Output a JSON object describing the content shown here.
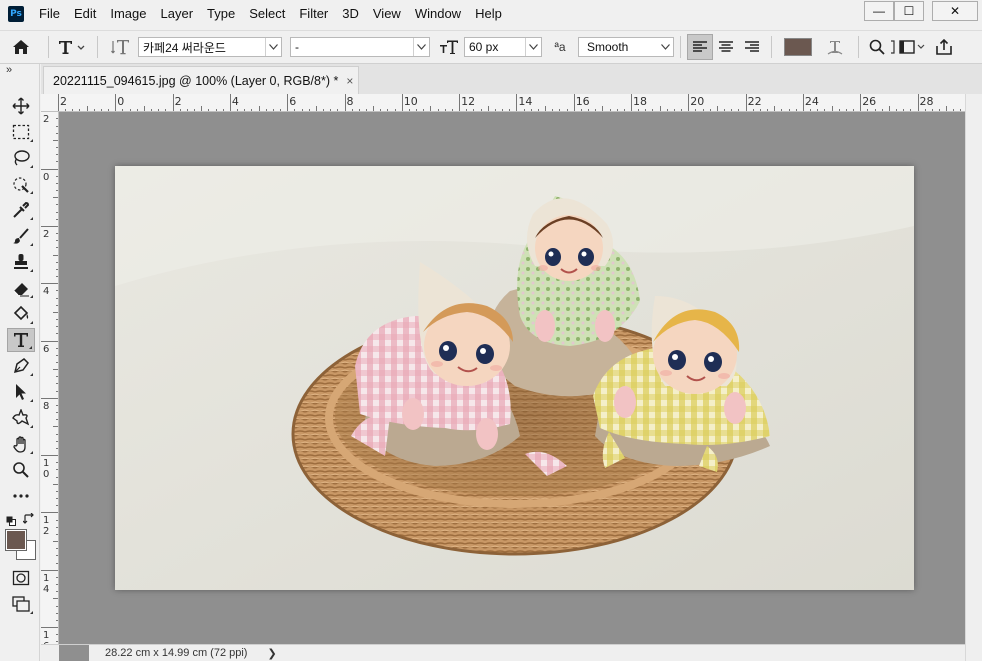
{
  "app": {
    "logo_text": "Ps",
    "menu": [
      "File",
      "Edit",
      "Image",
      "Layer",
      "Type",
      "Select",
      "Filter",
      "3D",
      "View",
      "Window",
      "Help"
    ],
    "window_controls": {
      "minimize": "—",
      "maximize": "☐",
      "close": "✕"
    }
  },
  "options": {
    "font_family": "카페24 써라운드",
    "font_style": "-",
    "font_size": "60 px",
    "antialias_label": "ªa",
    "antialias": "Smooth",
    "text_color": "#6b5850"
  },
  "document": {
    "tab_title": "20221115_094615.jpg @ 100% (Layer 0, RGB/8*) *",
    "tab_close": "×",
    "size_info": "28.22 cm x 14.99 cm (72 ppi)",
    "status_arrow": "❯"
  },
  "rulers": {
    "top": [
      "2",
      "0",
      "2",
      "4",
      "6",
      "8",
      "10",
      "12",
      "14",
      "16",
      "18",
      "20",
      "22",
      "24",
      "26",
      "28"
    ],
    "left": [
      "2",
      "0",
      "2",
      "4",
      "6",
      "8",
      "1\n0",
      "1\n2",
      "1\n4",
      "1\n6"
    ]
  },
  "colors": {
    "foreground": "#6b5850",
    "background": "#ffffff",
    "canvas_bg": "#8f8f8f"
  },
  "toolstrip": {
    "expand_label": "»",
    "tools": [
      "move-icon",
      "marquee-icon",
      "lasso-icon",
      "quick-select-icon",
      "eyedropper-icon",
      "brush-icon",
      "stamp-icon",
      "eraser-icon",
      "paint-bucket-icon",
      "type-icon",
      "pen-icon",
      "path-select-icon",
      "shape-icon",
      "hand-icon",
      "zoom-icon",
      "more-icon"
    ]
  }
}
